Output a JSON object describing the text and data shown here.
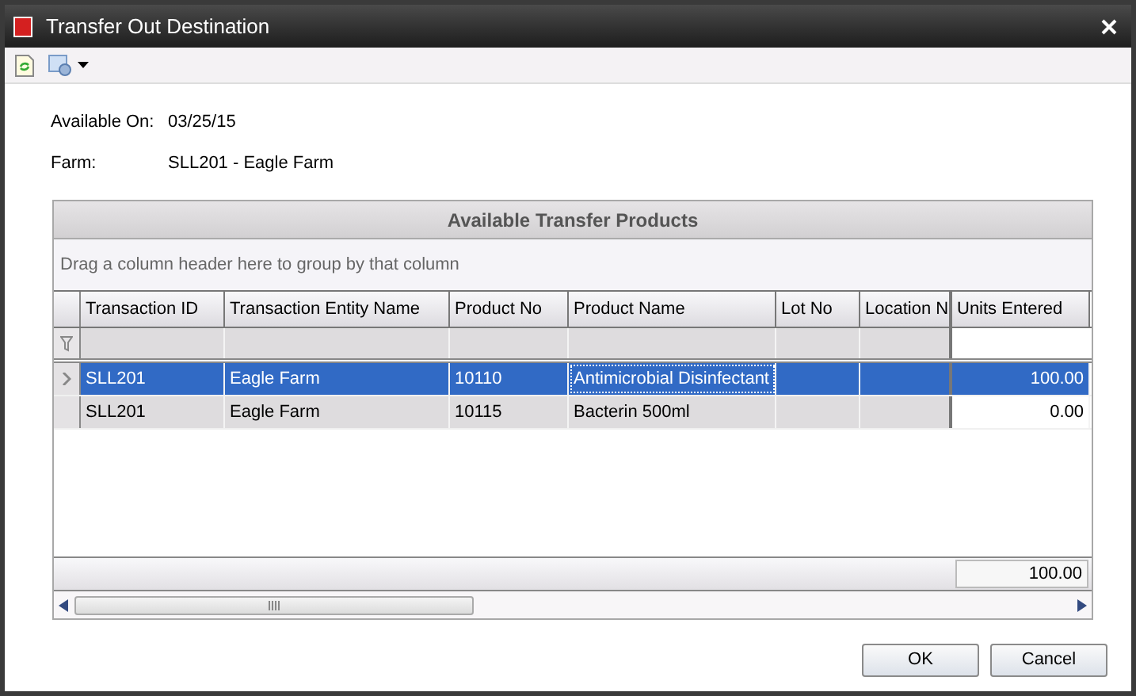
{
  "window": {
    "title": "Transfer Out Destination"
  },
  "fields": [
    {
      "label": "Available On:",
      "value": "03/25/15"
    },
    {
      "label": "Farm:",
      "value": "SLL201 - Eagle Farm"
    }
  ],
  "grid": {
    "title": "Available Transfer Products",
    "group_hint": "Drag a column header here to group by that column",
    "columns": [
      "Transaction ID",
      "Transaction Entity Name",
      "Product No",
      "Product Name",
      "Lot No",
      "Location N",
      "Units Entered"
    ],
    "rows": [
      {
        "selected": true,
        "cells": [
          "SLL201",
          "Eagle Farm",
          "10110",
          "Antimicrobial Disinfectant",
          "",
          "",
          "100.00"
        ]
      },
      {
        "selected": false,
        "cells": [
          "SLL201",
          "Eagle Farm",
          "10115",
          "Bacterin 500ml",
          "",
          "",
          "0.00"
        ]
      }
    ],
    "total": "100.00"
  },
  "buttons": [
    "OK",
    "Cancel"
  ]
}
